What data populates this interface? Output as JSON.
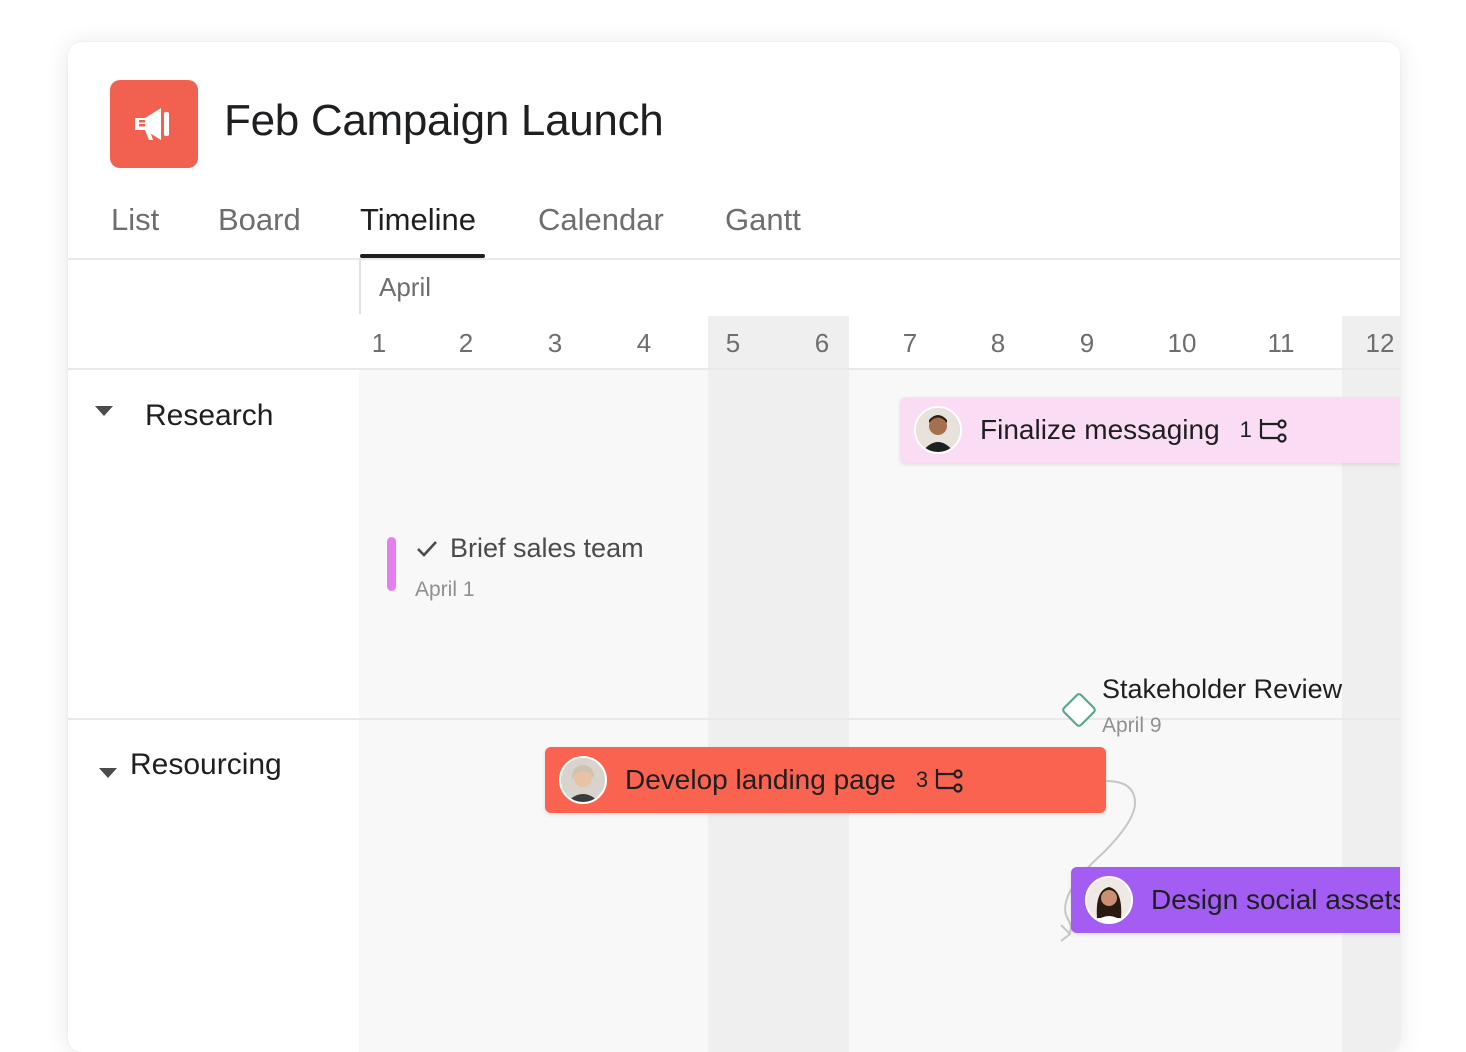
{
  "project": {
    "title": "Feb Campaign Launch",
    "icon": "megaphone-icon",
    "color": "#f2604f"
  },
  "tabs": [
    {
      "label": "List",
      "active": false
    },
    {
      "label": "Board",
      "active": false
    },
    {
      "label": "Timeline",
      "active": true
    },
    {
      "label": "Calendar",
      "active": false
    },
    {
      "label": "Gantt",
      "active": false
    }
  ],
  "timeline": {
    "month": "April",
    "days": [
      "1",
      "2",
      "3",
      "4",
      "5",
      "6",
      "7",
      "8",
      "9",
      "10",
      "11",
      "12"
    ],
    "weekend_days": [
      "5",
      "6",
      "12"
    ]
  },
  "sections": [
    {
      "label": "Research"
    },
    {
      "label": "Resourcing"
    }
  ],
  "tasks": {
    "finalize": {
      "label": "Finalize messaging",
      "subtasks": "1",
      "color": "#fbdcf5"
    },
    "brief": {
      "label": "Brief sales team",
      "date": "April 1",
      "accent": "#e57ff0"
    },
    "stakeholder": {
      "label": "Stakeholder Review",
      "date": "April 9",
      "accent": "#5aa88a"
    },
    "landing": {
      "label": "Develop landing page",
      "subtasks": "3",
      "color": "#fb6351"
    },
    "social": {
      "label": "Design social assets",
      "color": "#a35df2"
    }
  }
}
